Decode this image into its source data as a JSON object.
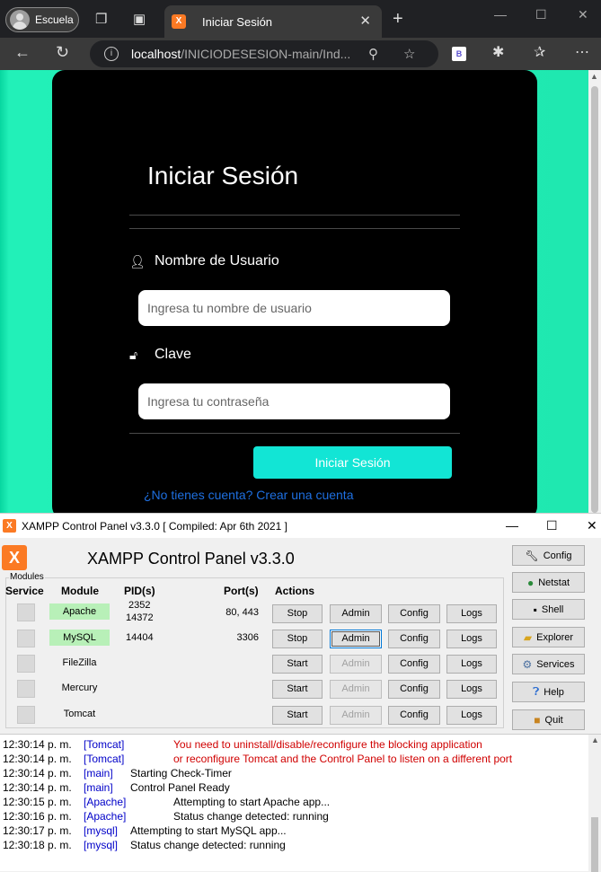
{
  "browser": {
    "profile_label": "Escuela",
    "tab_title": "Iniciar Sesión",
    "url_host": "localhost",
    "url_path": "/INICIODESESION-main/Ind...",
    "extension_label": "B"
  },
  "login": {
    "title": "Iniciar Sesión",
    "username_label": "Nombre de Usuario",
    "username_placeholder": "Ingresa tu nombre de usuario",
    "password_label": "Clave",
    "password_placeholder": "Ingresa tu contraseña",
    "submit_label": "Iniciar Sesión",
    "register_link": "¿No tienes cuenta? Crear una cuenta",
    "accent_color": "#12e5d5",
    "background_color": "#1fe8b0"
  },
  "xampp": {
    "window_title": "XAMPP Control Panel v3.3.0   [ Compiled: Apr 6th 2021 ]",
    "header": "XAMPP Control Panel v3.3.0",
    "modules_label": "Modules",
    "columns": {
      "service": "Service",
      "module": "Module",
      "pid": "PID(s)",
      "port": "Port(s)",
      "actions": "Actions"
    },
    "modules": [
      {
        "name": "Apache",
        "pid1": "2352",
        "pid2": "14372",
        "ports": "80, 443",
        "action": "Stop",
        "admin": "Admin",
        "config": "Config",
        "logs": "Logs",
        "running": true
      },
      {
        "name": "MySQL",
        "pid1": "14404",
        "pid2": "",
        "ports": "3306",
        "action": "Stop",
        "admin": "Admin",
        "config": "Config",
        "logs": "Logs",
        "running": true
      },
      {
        "name": "FileZilla",
        "pid1": "",
        "pid2": "",
        "ports": "",
        "action": "Start",
        "admin": "Admin",
        "config": "Config",
        "logs": "Logs",
        "running": false
      },
      {
        "name": "Mercury",
        "pid1": "",
        "pid2": "",
        "ports": "",
        "action": "Start",
        "admin": "Admin",
        "config": "Config",
        "logs": "Logs",
        "running": false
      },
      {
        "name": "Tomcat",
        "pid1": "",
        "pid2": "",
        "ports": "",
        "action": "Start",
        "admin": "Admin",
        "config": "Config",
        "logs": "Logs",
        "running": false
      }
    ],
    "side_buttons": [
      "Config",
      "Netstat",
      "Shell",
      "Explorer",
      "Services",
      "Help",
      "Quit"
    ],
    "log": [
      {
        "time": "12:30:14 p. m.",
        "source": "[Tomcat]",
        "message": "You need to uninstall/disable/reconfigure the blocking application",
        "error": true
      },
      {
        "time": "12:30:14 p. m.",
        "source": "[Tomcat]",
        "message": "or reconfigure Tomcat and the Control Panel to listen on a different port",
        "error": true
      },
      {
        "time": "12:30:14 p. m.",
        "source": "[main]",
        "message": "Starting Check-Timer",
        "error": false
      },
      {
        "time": "12:30:14 p. m.",
        "source": "[main]",
        "message": "Control Panel Ready",
        "error": false
      },
      {
        "time": "12:30:15 p. m.",
        "source": "[Apache]",
        "message": "Attempting to start Apache app...",
        "error": false
      },
      {
        "time": "12:30:16 p. m.",
        "source": "[Apache]",
        "message": "Status change detected: running",
        "error": false
      },
      {
        "time": "12:30:17 p. m.",
        "source": "[mysql]",
        "message": "Attempting to start MySQL app...",
        "error": false
      },
      {
        "time": "12:30:18 p. m.",
        "source": "[mysql]",
        "message": "Status change detected: running",
        "error": false
      }
    ]
  }
}
